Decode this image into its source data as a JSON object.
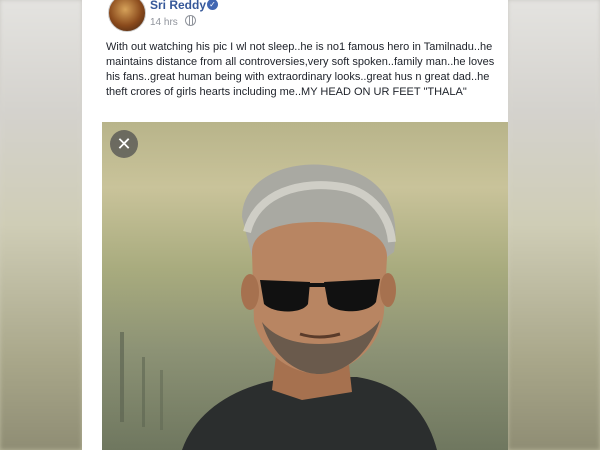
{
  "post": {
    "author": "Sri Reddy",
    "timestamp": "14 hrs",
    "verified_icon": "verified-check-icon",
    "privacy_icon": "globe-icon",
    "text": "With out watching his pic I wl not sleep..he is no1 famous hero in Tamilnadu..he maintains distance from all controversies,very soft spoken..family man..he loves his fans..great human being with extraordinary looks..great hus n great dad..he theft crores of girls hearts including me..MY HEAD ON UR FEET \"THALA\"",
    "close_icon": "close-icon",
    "close_symbol": "✕"
  },
  "colors": {
    "name_link": "#365899",
    "verified_badge": "#4267b2",
    "meta_text": "#90949c",
    "body_text": "#1d2129"
  }
}
